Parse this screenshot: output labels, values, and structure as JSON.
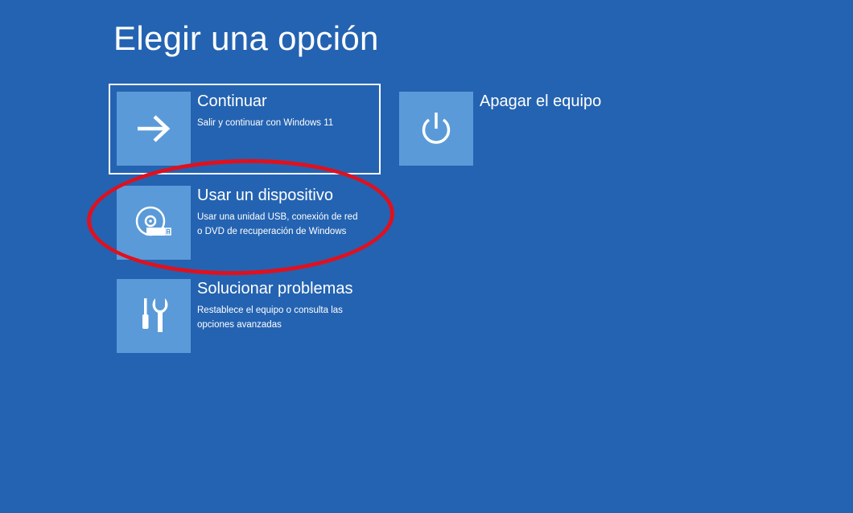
{
  "page": {
    "title": "Elegir una opción"
  },
  "options": [
    {
      "id": "continue",
      "title": "Continuar",
      "description": [
        "Salir y continuar con Windows 11"
      ],
      "icon": "arrow-right-icon",
      "selected": true
    },
    {
      "id": "shutdown",
      "title": "Apagar el equipo",
      "description": [],
      "icon": "power-icon",
      "selected": false
    },
    {
      "id": "device",
      "title": "Usar un dispositivo",
      "description": [
        "Usar una unidad USB, conexión de red",
        "o DVD de recuperación de Windows"
      ],
      "icon": "disc-usb-icon",
      "selected": false
    },
    {
      "id": "troubleshoot",
      "title": "Solucionar problemas",
      "description": [
        "Restablece el equipo o consulta las",
        "opciones avanzadas"
      ],
      "icon": "tools-icon",
      "selected": false
    }
  ],
  "annotation": {
    "type": "red-ellipse",
    "target": "device",
    "color": "#e0101e"
  },
  "colors": {
    "background": "#2463b1",
    "tile": "#5b9ad8",
    "text": "#ffffff"
  }
}
